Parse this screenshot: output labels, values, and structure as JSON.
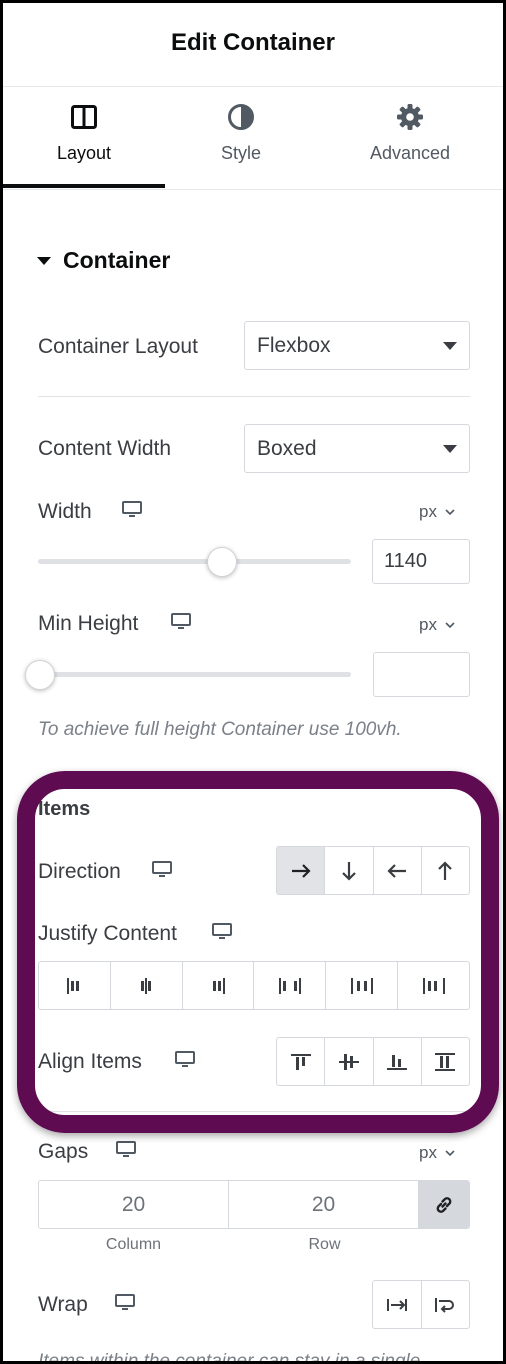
{
  "header": {
    "title": "Edit Container"
  },
  "tabs": [
    {
      "label": "Layout",
      "icon": "columns-layout-icon",
      "active": true
    },
    {
      "label": "Style",
      "icon": "half-circle-contrast-icon",
      "active": false
    },
    {
      "label": "Advanced",
      "icon": "gear-icon",
      "active": false
    }
  ],
  "section": {
    "title": "Container"
  },
  "container_layout": {
    "label": "Container Layout",
    "value": "Flexbox"
  },
  "content_width": {
    "label": "Content Width",
    "value": "Boxed"
  },
  "width": {
    "label": "Width",
    "unit": "px",
    "value": "1140",
    "slider_fraction": 0.58
  },
  "min_height": {
    "label": "Min Height",
    "unit": "px",
    "value": "",
    "slider_fraction": 0.0
  },
  "note_full_height": "To achieve full height Container use 100vh.",
  "items": {
    "heading": "Items",
    "direction": {
      "label": "Direction",
      "options": [
        "row",
        "column",
        "row-reverse",
        "column-reverse"
      ],
      "selected": "row"
    },
    "justify_content": {
      "label": "Justify Content",
      "options": [
        "start",
        "center",
        "end",
        "space-between",
        "space-around",
        "space-evenly"
      ]
    },
    "align_items": {
      "label": "Align Items",
      "options": [
        "start",
        "center",
        "end",
        "stretch"
      ]
    }
  },
  "gaps": {
    "label": "Gaps",
    "unit": "px",
    "column_value": "20",
    "row_value": "20",
    "column_caption": "Column",
    "row_caption": "Row"
  },
  "wrap": {
    "label": "Wrap",
    "options": [
      "nowrap",
      "wrap"
    ]
  },
  "note_wrap": "Items within the container can stay in a single",
  "colors": {
    "highlight": "#5e0b52",
    "active_tab": "#0c0d0e"
  }
}
